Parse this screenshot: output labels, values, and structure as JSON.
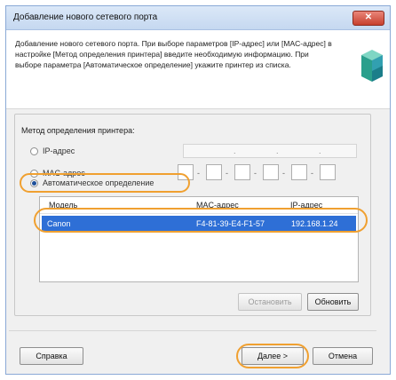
{
  "window": {
    "title": "Добавление нового сетевого порта",
    "close_label": "✕"
  },
  "header": {
    "description": "Добавление нового сетевого порта. При выборе параметров [IP-адрес] или [MAC-адрес] в настройке [Метод определения принтера] введите необходимую информацию. При выборе параметра [Автоматическое определение] укажите принтер из списка."
  },
  "method": {
    "group_title": "Метод определения принтера:",
    "ip_label": "IP-адрес",
    "mac_label": "MAC-адрес",
    "auto_label": "Автоматическое определение",
    "selected": "auto",
    "ip_dots": [
      ".",
      ".",
      "."
    ],
    "mac_dashes": [
      "-",
      "-",
      "-",
      "-",
      "-"
    ]
  },
  "list": {
    "columns": [
      "Модель",
      "MAC-адрес",
      "IP-адрес"
    ],
    "rows": [
      {
        "model": "Canon",
        "mac": "F4-81-39-E4-F1-57",
        "ip": "192.168.1.24"
      }
    ]
  },
  "buttons": {
    "stop": "Остановить",
    "refresh": "Обновить",
    "help": "Справка",
    "next": "Далее >",
    "cancel": "Отмена"
  },
  "colors": {
    "highlight": "#f0a030",
    "selection": "#2e6fd6"
  }
}
